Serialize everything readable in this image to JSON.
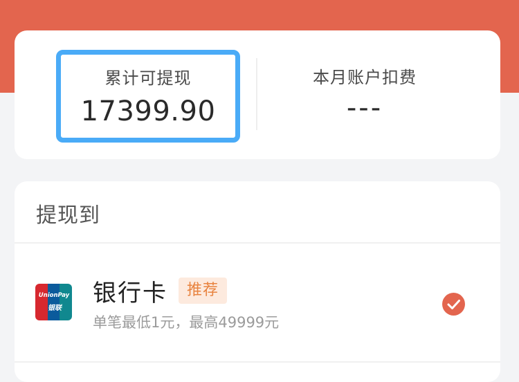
{
  "stats": {
    "total_label": "累计可提现",
    "total_value": "17399.90",
    "month_label": "本月账户扣费",
    "month_value": "---"
  },
  "withdraw": {
    "section_title": "提现到",
    "option": {
      "icon": "unionpay-icon",
      "logo_text": "UnionPay",
      "logo_subtext": "银联",
      "name": "银行卡",
      "badge": "推荐",
      "description": "单笔最低1元，最高49999元",
      "selected": true
    }
  },
  "colors": {
    "accent": "#e3654e",
    "highlight_border": "#4aabf7",
    "badge_bg": "#fdeade",
    "badge_text": "#e8833f"
  }
}
